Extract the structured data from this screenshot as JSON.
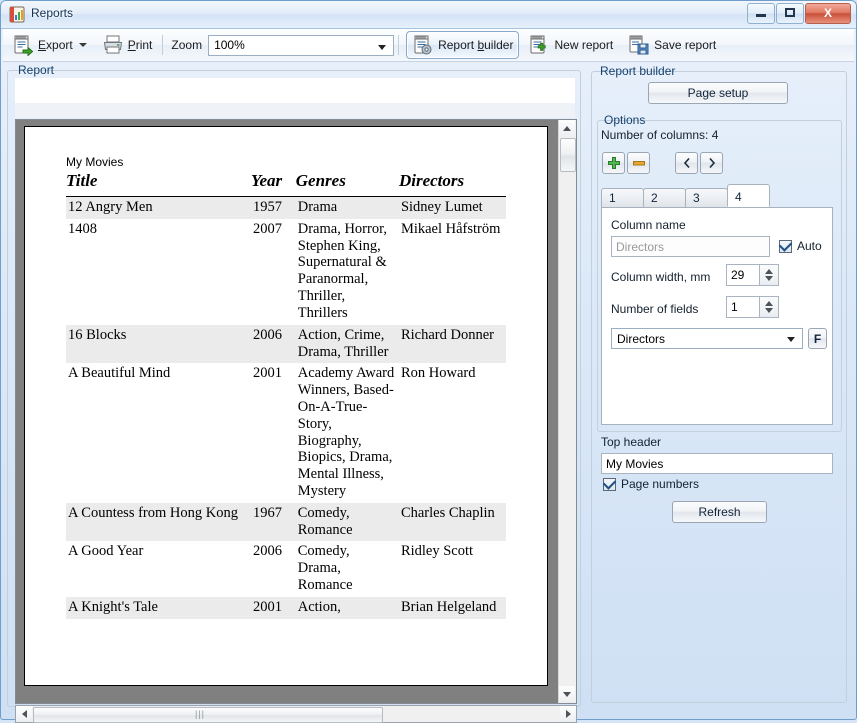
{
  "window": {
    "title": "Reports",
    "app_icon": "report-app-icon",
    "minimize_label": "",
    "maximize_label": "",
    "close_label": "X"
  },
  "toolbar": {
    "export_label": "Export",
    "export_icon": "export-icon",
    "export_dropdown_icon": "chevron-down-icon",
    "print_label": "Print",
    "print_icon": "printer-icon",
    "zoom_label": "Zoom",
    "zoom_value": "100%",
    "zoom_dropdown_icon": "chevron-down-icon",
    "report_builder_label": "Report builder",
    "report_builder_icon": "report-builder-icon",
    "new_report_label": "New report",
    "new_report_icon": "new-report-icon",
    "save_report_label": "Save report",
    "save_report_icon": "save-report-icon"
  },
  "report_group": {
    "label": "Report"
  },
  "document": {
    "top_header": "My Movies",
    "columns": [
      "Title",
      "Year",
      "Genres",
      "Directors"
    ],
    "rows": [
      {
        "title": "12 Angry Men",
        "year": "1957",
        "genres": "Drama",
        "directors": "Sidney Lumet",
        "shaded": true
      },
      {
        "title": "1408",
        "year": "2007",
        "genres": "Drama, Horror, Stephen King, Supernatural & Paranormal, Thriller, Thrillers",
        "directors": "Mikael Håfström",
        "shaded": false
      },
      {
        "title": "16 Blocks",
        "year": "2006",
        "genres": "Action, Crime, Drama, Thriller",
        "directors": "Richard Donner",
        "shaded": true
      },
      {
        "title": "A Beautiful Mind",
        "year": "2001",
        "genres": "Academy Award Winners, Based-On-A-True-Story, Biography, Biopics, Drama, Mental Illness, Mystery",
        "directors": "Ron Howard",
        "shaded": false
      },
      {
        "title": "A Countess from Hong Kong",
        "year": "1967",
        "genres": "Comedy, Romance",
        "directors": "Charles Chaplin",
        "shaded": true
      },
      {
        "title": "A Good Year",
        "year": "2006",
        "genres": "Comedy, Drama, Romance",
        "directors": "Ridley Scott",
        "shaded": false
      },
      {
        "title": "A Knight's Tale",
        "year": "2001",
        "genres": "Action,",
        "directors": "Brian Helgeland",
        "shaded": true
      }
    ]
  },
  "report_builder": {
    "group_label": "Report builder",
    "page_setup_label": "Page setup",
    "options_label": "Options",
    "number_of_columns_label": "Number of columns: 4",
    "add_icon": "plus-icon",
    "remove_icon": "minus-icon",
    "prev_icon": "chevron-left-icon",
    "next_icon": "chevron-right-icon",
    "tabs": [
      "1",
      "2",
      "3",
      "4"
    ],
    "active_tab": "4",
    "column_name_label": "Column name",
    "column_name_value": "Directors",
    "auto_label": "Auto",
    "auto_checked": true,
    "column_width_label": "Column width, mm",
    "column_width_value": "29",
    "number_of_fields_label": "Number of fields",
    "number_of_fields_value": "1",
    "field_combo_value": "Directors",
    "font_button_label": "F",
    "top_header_label": "Top header",
    "top_header_value": "My Movies",
    "page_numbers_label": "Page numbers",
    "page_numbers_checked": true,
    "refresh_label": "Refresh"
  },
  "scrollbars": {
    "vertical_up_icon": "triangle-up-icon",
    "vertical_down_icon": "triangle-down-icon",
    "horizontal_left_icon": "triangle-left-icon",
    "horizontal_right_icon": "triangle-right-icon",
    "grip": "|||"
  },
  "colors": {
    "accent": "#1e4f86",
    "close_red": "#c9503a",
    "plus_green": "#3c9a3c",
    "minus_orange": "#e8a020",
    "row_shade": "#ebebeb"
  }
}
